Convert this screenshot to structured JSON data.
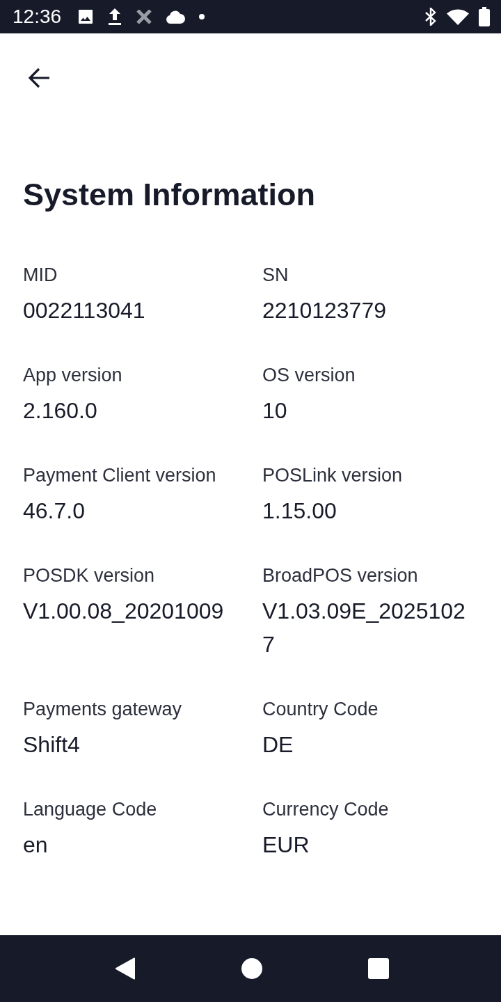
{
  "status_bar": {
    "time": "12:36"
  },
  "title": "System Information",
  "items": [
    {
      "label": "MID",
      "value": "0022113041"
    },
    {
      "label": "SN",
      "value": "2210123779"
    },
    {
      "label": "App version",
      "value": "2.160.0"
    },
    {
      "label": "OS version",
      "value": "10"
    },
    {
      "label": "Payment Client version",
      "value": "46.7.0"
    },
    {
      "label": "POSLink version",
      "value": "1.15.00"
    },
    {
      "label": "POSDK version",
      "value": "V1.00.08_20201009"
    },
    {
      "label": "BroadPOS version",
      "value": "V1.03.09E_20251027"
    },
    {
      "label": "Payments gateway",
      "value": "Shift4"
    },
    {
      "label": "Country Code",
      "value": "DE"
    },
    {
      "label": "Language Code",
      "value": "en"
    },
    {
      "label": "Currency Code",
      "value": "EUR"
    }
  ]
}
